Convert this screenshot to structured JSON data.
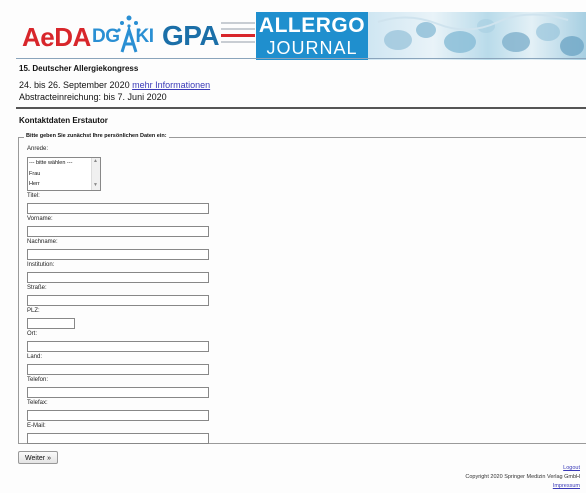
{
  "header": {
    "logo1": "AeDA",
    "logo2_left": "DG",
    "logo2_right": "KI",
    "logo3": "GPA",
    "journal_line1": "ALLERGO",
    "journal_line2": "JOURNAL",
    "colors": {
      "red": "#d8262b",
      "blue": "#1f8fce",
      "darkblue": "#1b6fa8"
    }
  },
  "event": {
    "title": "15. Deutscher Allergiekongress",
    "dates": "24. bis 26. September 2020",
    "more_link": "mehr Informationen",
    "deadline": "Abstracteinreichung: bis 7. Juni 2020"
  },
  "section": {
    "title": "Kontaktdaten Erstautor",
    "legend": "Bitte geben Sie zunächst Ihre persönlichen Daten ein:"
  },
  "form": {
    "anrede_label": "Anrede:",
    "anrede_options": [
      "--- bitte wählen ---",
      "Frau",
      "Herr"
    ],
    "fields": [
      {
        "label": "Titel:",
        "value": ""
      },
      {
        "label": "Vorname:",
        "value": ""
      },
      {
        "label": "Nachname:",
        "value": ""
      },
      {
        "label": "Institution:",
        "value": ""
      },
      {
        "label": "Straße:",
        "value": ""
      },
      {
        "label": "PLZ:",
        "value": ""
      },
      {
        "label": "Ort:",
        "value": ""
      },
      {
        "label": "Land:",
        "value": ""
      },
      {
        "label": "Telefon:",
        "value": ""
      },
      {
        "label": "Telefax:",
        "value": ""
      },
      {
        "label": "E-Mail:",
        "value": ""
      }
    ],
    "submit_label": "Weiter »"
  },
  "footer": {
    "logout": "Logout",
    "copyright": "Copyright 2020 Springer Medizin Verlag GmbH",
    "impressum": "Impressum"
  }
}
